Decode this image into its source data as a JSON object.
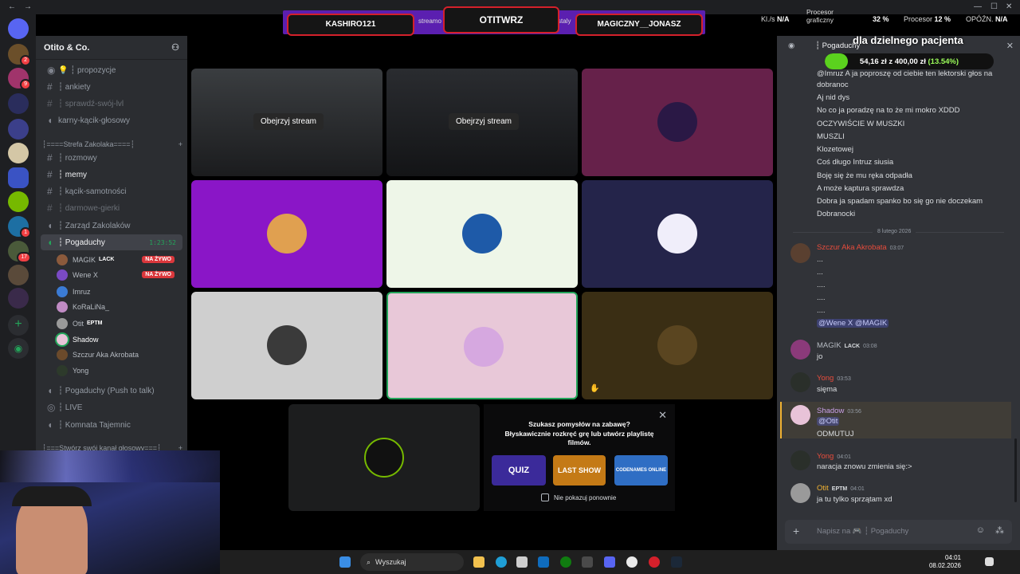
{
  "window": {
    "title": "Otito & Co."
  },
  "overlay": {
    "left_name": "KASHIRO121",
    "center_name": "OTITWRZ",
    "right_name": "MAGICZNY__JONASZ",
    "ticker_left": "streamo",
    "ticker_right": "staly",
    "stats": {
      "kl_label": "Kl./s",
      "kl_value": "N/A",
      "gpu_label": "Procesor graficzny",
      "gpu_value": "32 %",
      "cpu_label": "Procesor",
      "cpu_value": "12 %",
      "delay_label": "OPÓŹN.",
      "delay_value": "N/A"
    }
  },
  "donation": {
    "title": "dla dzielnego pacjenta",
    "current": "54,16 zł",
    "goal": "z 400,00 zł",
    "percent": "(13.54%)",
    "progress": 0.1354
  },
  "guild": {
    "name": "Otito & Co."
  },
  "channels": [
    {
      "label": "💡 ┆ propozycje",
      "kind": "text"
    },
    {
      "label": "┆ ankiety",
      "kind": "text"
    },
    {
      "label": "┆ sprawdź-swój-lvl",
      "kind": "text"
    },
    {
      "label": "karny-kącik-głosowy",
      "kind": "voice"
    }
  ],
  "category_1": "┆====Strefa Zakolaka====┆",
  "channels_2": [
    {
      "label": "┆ rozmowy"
    },
    {
      "label": "┆ memy"
    },
    {
      "label": "┆ kącik-samotności"
    },
    {
      "label": "┆ darmowe-gierki"
    },
    {
      "label": "┆ Zarząd Zakolaków"
    },
    {
      "label": "┆ Pogaduchy",
      "timer": "1:23:52"
    }
  ],
  "voice_users": [
    {
      "name": "MAGIK",
      "tag": "LACK",
      "live": "NA ŻYWO"
    },
    {
      "name": "Wene X",
      "live": "NA ŻYWO"
    },
    {
      "name": "Imruz"
    },
    {
      "name": "KoRaLiNa_"
    },
    {
      "name": "Otit",
      "tag": "EPTM"
    },
    {
      "name": "Shadow"
    },
    {
      "name": "Szczur Aka Akrobata"
    },
    {
      "name": "Yong"
    }
  ],
  "channels_3": [
    {
      "label": "┆ Pogaduchy (Push to talk)"
    },
    {
      "label": "┆ LIVE"
    },
    {
      "label": "┆ Komnata Tajemnic"
    }
  ],
  "category_2": "┆===Stwórz swój kanał głosowy===┆",
  "stage": {
    "watch_label": "Obejrzyj stream",
    "activity_prompt": "Szukasz pomysłów na zabawę?",
    "activity_desc": "Błyskawicznie rozkręć grę lub utwórz playlistę filmów.",
    "dont_show": "Nie pokazuj ponownie",
    "games": [
      "QUIZ",
      "LAST SHOW",
      "CODENAMES ONLINE"
    ]
  },
  "chat": {
    "channel": "┆ Pogaduchy",
    "placeholder": "Napisz na 🎮 ┆ Pogaduchy",
    "top_lines": [
      "@Imruz A ja poproszę od ciebie ten lektorski głos na",
      "dobranoc",
      "Aj nid dys",
      "No co ja poradzę na to że mi mokro XDDD",
      "OCZYWIŚCIE W MUSZKI",
      "MUSZLI",
      "Klozetowej",
      "Coś długo Intruz siusia",
      "Boję się że mu ręka odpadła",
      "A może kaptura sprawdza",
      "Dobra ja spadam spanko bo się go nie doczekam",
      "Dobranocki"
    ],
    "date_divider": "8 lutego 2026",
    "messages": [
      {
        "author": "Szczur Aka Akrobata",
        "time": "03:07",
        "lines": [
          "...",
          "...",
          "....",
          "....",
          "...."
        ],
        "mention": "@Wene X @MAGIK"
      },
      {
        "author": "MAGIK",
        "tag": "LACK",
        "time": "03:08",
        "text": "jo"
      },
      {
        "author": "Yong",
        "time": "03:53",
        "text": "sięma"
      },
      {
        "author": "Shadow",
        "time": "03:56",
        "mention": "@Otit",
        "text": "ODMUTUJ"
      },
      {
        "author": "Yong",
        "time": "04:01",
        "text": "naracja znowu zmienia się:>"
      },
      {
        "author": "Otit",
        "tag": "EPTM",
        "time": "04:01",
        "text": "ja tu tylko sprzątam xd"
      }
    ]
  },
  "taskbar": {
    "search": "Wyszukaj",
    "time": "04:01",
    "date": "08.02.2026"
  }
}
